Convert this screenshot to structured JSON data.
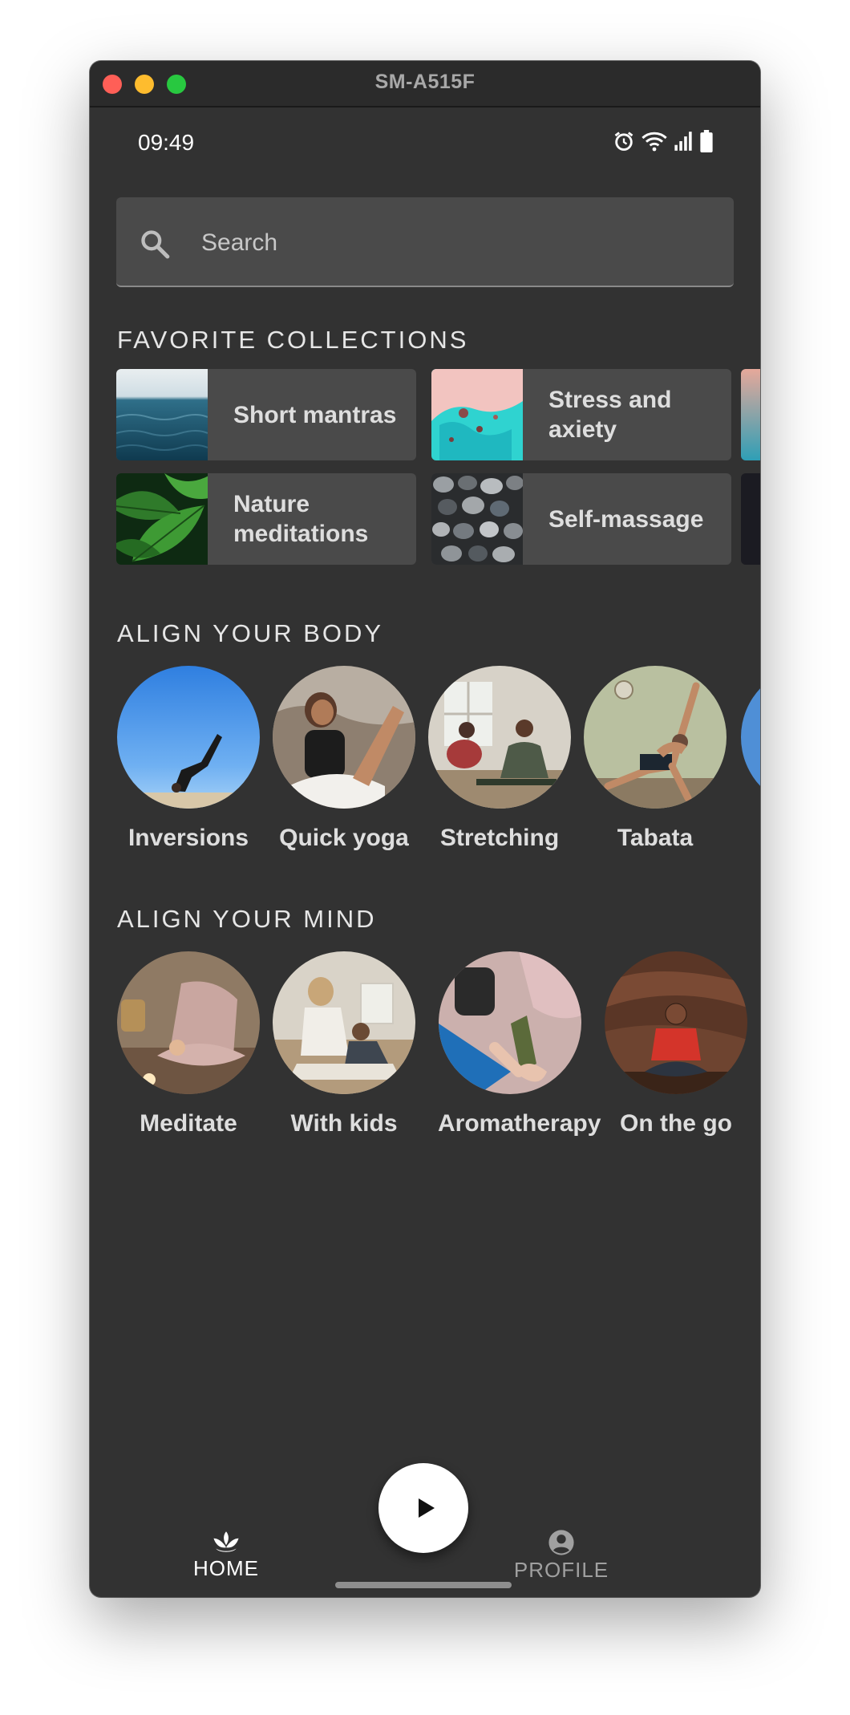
{
  "window": {
    "title": "SM-A515F"
  },
  "status_bar": {
    "time": "09:49",
    "icons": [
      "alarm-icon",
      "wifi-icon",
      "signal-icon",
      "battery-icon"
    ]
  },
  "search": {
    "placeholder": "Search",
    "icon": "search-icon"
  },
  "favorites": {
    "title": "FAVORITE COLLECTIONS",
    "items": [
      {
        "label": "Short mantras",
        "thumb": "ocean-waves"
      },
      {
        "label": "Stress and axiety",
        "thumb": "turquoise-shore"
      },
      {
        "label": "Nature meditations",
        "thumb": "green-leaves"
      },
      {
        "label": "Self-massage",
        "thumb": "pebbles"
      }
    ]
  },
  "body": {
    "title": "ALIGN YOUR BODY",
    "items": [
      {
        "label": "Inversions"
      },
      {
        "label": "Quick yoga"
      },
      {
        "label": "Stretching"
      },
      {
        "label": "Tabata"
      }
    ]
  },
  "mind": {
    "title": "ALIGN YOUR MIND",
    "items": [
      {
        "label": "Meditate"
      },
      {
        "label": "With kids"
      },
      {
        "label": "Aromatherapy"
      },
      {
        "label": "On the go"
      }
    ]
  },
  "nav": {
    "home": {
      "label": "HOME",
      "icon": "lotus-icon",
      "active": true
    },
    "play": {
      "icon": "play-icon"
    },
    "profile": {
      "label": "PROFILE",
      "icon": "account-circle-icon"
    }
  },
  "colors": {
    "background": "#323232",
    "card": "#4a4a4a",
    "text": "#dedede",
    "nav_inactive": "#a0a0a0"
  }
}
